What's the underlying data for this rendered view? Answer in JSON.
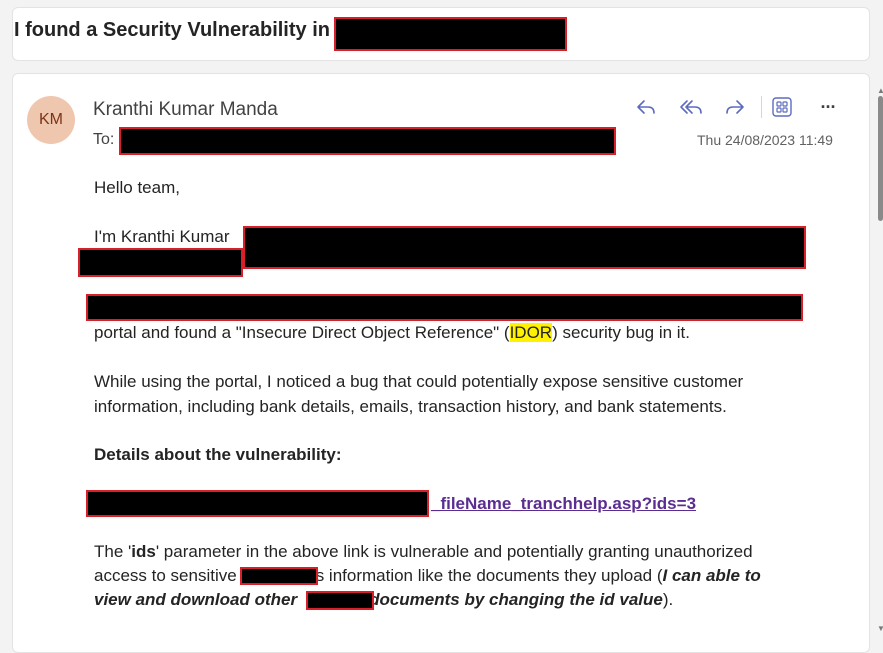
{
  "subject": {
    "title": "I found a Security Vulnerability in"
  },
  "sender": {
    "initials": "KM",
    "name": "Kranthi Kumar Manda",
    "to_label": "To:",
    "date": "Thu 24/08/2023 11:49"
  },
  "toolbar": {
    "icons": [
      "reply-icon",
      "reply-all-icon",
      "forward-icon",
      "apps-icon",
      "more-icon"
    ],
    "more_label": "···"
  },
  "body": {
    "greeting": "Hello team,",
    "intro": "I'm Kranthi Kumar",
    "portal_before": "portal and found a \"Insecure Direct Object Reference\" (",
    "portal_highlight": "IDOR",
    "portal_after": ") security bug in it.",
    "p2_line1": "While using the portal, I noticed a bug that could potentially expose sensitive customer",
    "p2_line2": "information, including bank details, emails, transaction history, and bank statements.",
    "details_heading": "Details about the vulnerability:",
    "link_text": "_fileName_tranchhelp.asp?ids=3",
    "p3_a": "The '",
    "p3_bold": "ids",
    "p3_b": "' parameter in the above link is vulnerable and potentially granting unauthorized",
    "p3_line2_a": "access to sensitive",
    "p3_line2_b": "s information like the documents they upload (",
    "p3_line2_c": "I can able to",
    "p3_line3_a": "view and download other",
    "p3_line3_b": "documents by changing the id value",
    "p3_line3_c": ")."
  },
  "colors": {
    "accent": "#5c6bc0",
    "link": "#5c2d91",
    "highlight": "#fff100",
    "redaction_border": "#d8202a",
    "avatar_bg": "#efc6ae"
  }
}
